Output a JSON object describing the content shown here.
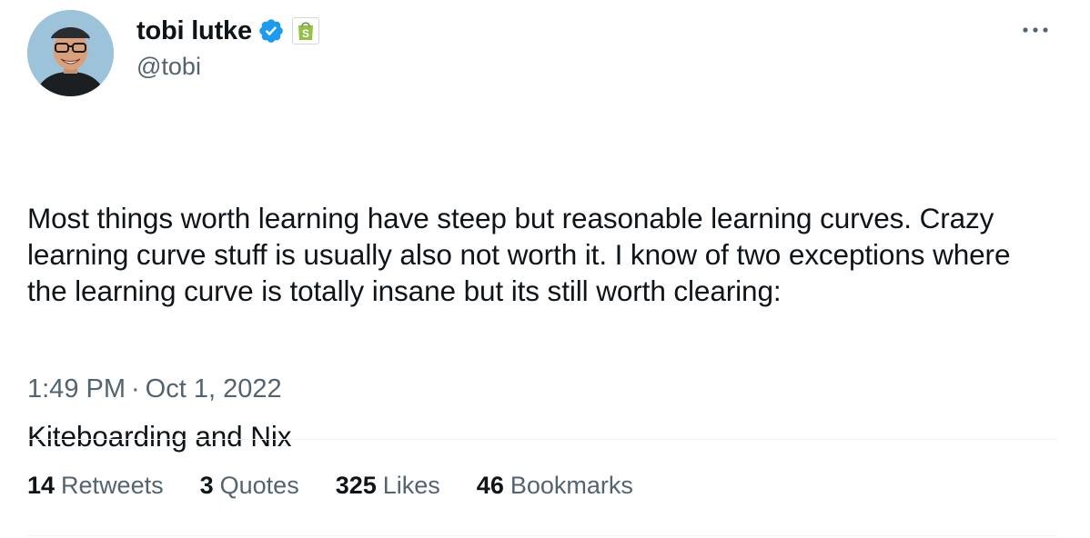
{
  "author": {
    "display_name": "tobi lutke",
    "handle": "@tobi",
    "verified": true,
    "affiliate_badge": "shopify-bag-icon"
  },
  "tweet": {
    "paragraphs": [
      "Most things worth learning have steep but reasonable learning curves. Crazy learning curve stuff is usually also not worth it. I know of two exceptions where the learning curve is totally insane but its still worth clearing:",
      "Kiteboarding and Nix"
    ],
    "time": "1:49 PM",
    "separator": "·",
    "date": "Oct 1, 2022"
  },
  "stats": [
    {
      "count": "14",
      "label": "Retweets"
    },
    {
      "count": "3",
      "label": "Quotes"
    },
    {
      "count": "325",
      "label": "Likes"
    },
    {
      "count": "46",
      "label": "Bookmarks"
    }
  ],
  "colors": {
    "verified": "#1d9bf0",
    "shopify": "#95bf47",
    "secondary_text": "#536471",
    "primary_text": "#0f1419",
    "divider": "#eff3f4"
  },
  "icons": {
    "more": "more-horizontal-icon",
    "verified": "verified-badge-icon"
  }
}
